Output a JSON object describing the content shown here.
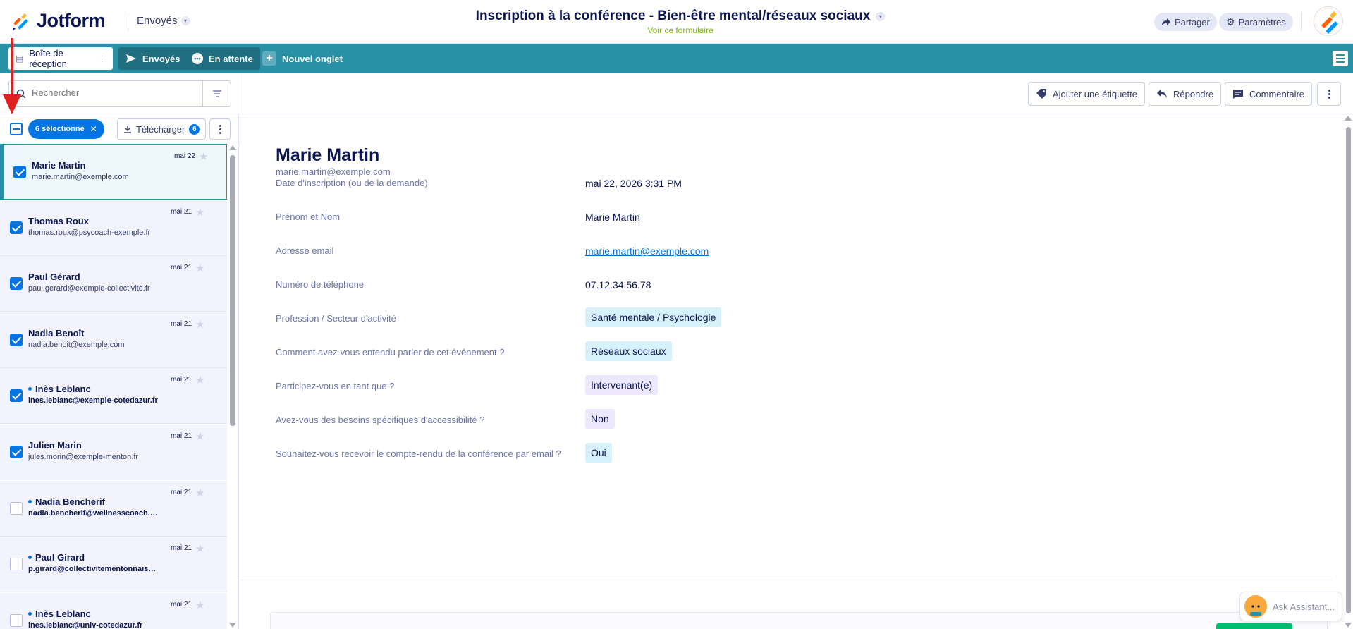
{
  "header": {
    "logo_text": "Jotform",
    "form_switch_label": "Envoyés",
    "form_title": "Inscription à la conférence - Bien-être mental/réseaux sociaux",
    "view_form_link": "Voir ce formulaire",
    "share_label": "Partager",
    "settings_label": "Paramètres"
  },
  "tabs": [
    {
      "label": "Boîte de réception"
    },
    {
      "label": "Envoyés"
    },
    {
      "label": "En attente"
    },
    {
      "label": "Nouvel onglet"
    }
  ],
  "search": {
    "placeholder": "Rechercher"
  },
  "actions": {
    "add_tag": "Ajouter une étiquette",
    "reply": "Répondre",
    "comment": "Commentaire"
  },
  "selection": {
    "selected_label": "6 sélectionné",
    "download_label": "Télécharger",
    "download_count": "6"
  },
  "submissions": [
    {
      "name": "Marie Martin",
      "email": "marie.martin@exemple.com",
      "date": "mai 22",
      "checked": true,
      "unread": false,
      "active": true
    },
    {
      "name": "Thomas Roux",
      "email": "thomas.roux@psycoach-exemple.fr",
      "date": "mai 21",
      "checked": true,
      "unread": false,
      "active": false
    },
    {
      "name": "Paul Gérard",
      "email": "paul.gerard@exemple-collectivite.fr",
      "date": "mai 21",
      "checked": true,
      "unread": false,
      "active": false
    },
    {
      "name": "Nadia Benoît",
      "email": "nadia.benoit@exemple.com",
      "date": "mai 21",
      "checked": true,
      "unread": false,
      "active": false
    },
    {
      "name": "Inès Leblanc",
      "email": "ines.leblanc@exemple-cotedazur.fr",
      "date": "mai 21",
      "checked": true,
      "unread": true,
      "active": false
    },
    {
      "name": "Julien Marin",
      "email": "jules.morin@exemple-menton.fr",
      "date": "mai 21",
      "checked": true,
      "unread": false,
      "active": false
    },
    {
      "name": "Nadia Bencherif",
      "email": "nadia.bencherif@wellnesscoach.…",
      "date": "mai 21",
      "checked": false,
      "unread": true,
      "active": false
    },
    {
      "name": "Paul Girard",
      "email": "p.girard@collectivitementonnais…",
      "date": "mai 21",
      "checked": false,
      "unread": true,
      "active": false
    },
    {
      "name": "Inès Leblanc",
      "email": "ines.leblanc@univ-cotedazur.fr",
      "date": "mai 21",
      "checked": false,
      "unread": true,
      "active": false
    }
  ],
  "detail": {
    "name": "Marie Martin",
    "email": "marie.martin@exemple.com",
    "fields": [
      {
        "label": "Date d'inscription (ou de la demande)",
        "value": "mai 22, 2026 3:31 PM",
        "kind": "text"
      },
      {
        "label": "Prénom et Nom",
        "value": "Marie Martin",
        "kind": "text"
      },
      {
        "label": "Adresse email",
        "value": "marie.martin@exemple.com",
        "kind": "link"
      },
      {
        "label": "Numéro de téléphone",
        "value": "07.12.34.56.78",
        "kind": "text"
      },
      {
        "label": "Profession / Secteur d'activité",
        "value": "Santé mentale / Psychologie",
        "kind": "chip-blue"
      },
      {
        "label": "Comment avez-vous entendu parler de cet événement ?",
        "value": "Réseaux sociaux",
        "kind": "chip-blue"
      },
      {
        "label": "Participez-vous en tant que ?",
        "value": "Intervenant(e)",
        "kind": "chip-purple"
      },
      {
        "label": "Avez-vous des besoins spécifiques d'accessibilité ?",
        "value": "Non",
        "kind": "chip-purple"
      },
      {
        "label": "Souhaitez-vous recevoir le compte-rendu de la conférence par email ?",
        "value": "Oui",
        "kind": "chip-blue"
      }
    ]
  },
  "assistant": {
    "label": "Ask Assistant..."
  },
  "colors": {
    "brand_navy": "#0a1551",
    "tab_bar": "#2891a6",
    "accent_blue": "#0075e3",
    "annotation_red": "#e02020"
  }
}
